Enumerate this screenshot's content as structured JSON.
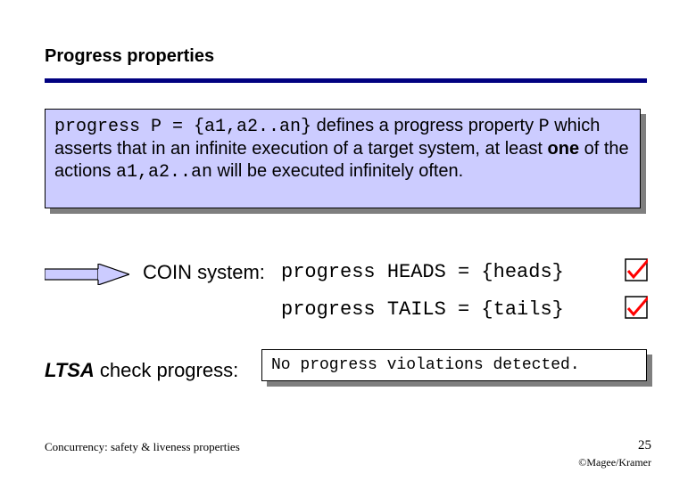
{
  "title": "Progress properties",
  "definition": {
    "code1": "progress P = {a1,a2..an}",
    "text1_a": " defines a progress property ",
    "code2": "P",
    "text1_b": " which asserts that in an infinite execution of a target system, at least ",
    "bold": "one",
    "text2": " of the actions ",
    "code3": "a1,a2..an",
    "text3": " will be executed infinitely often."
  },
  "coin": {
    "label": "COIN system: ",
    "line1": "progress HEADS = {heads}",
    "line2": "progress TAILS = {tails}"
  },
  "ltsa": {
    "label_italic": "LTSA",
    "label_rest": " check progress:",
    "result": "No progress violations detected."
  },
  "footer": {
    "left": "Concurrency: safety & liveness properties",
    "page": "25",
    "copyright": "©Magee/Kramer"
  },
  "icons": {
    "arrow": "arrow-right",
    "check": "checkbox-checked"
  }
}
